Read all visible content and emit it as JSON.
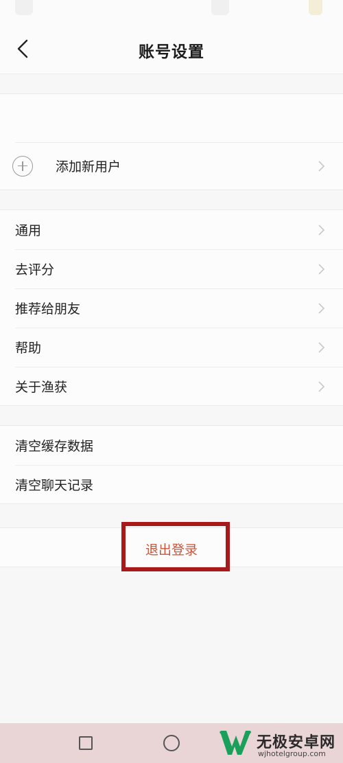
{
  "header": {
    "title": "账号设置"
  },
  "account_group": {
    "add_user_label": "添加新用户"
  },
  "general_group": {
    "items": [
      {
        "label": "通用"
      },
      {
        "label": "去评分"
      },
      {
        "label": "推荐给朋友"
      },
      {
        "label": "帮助"
      },
      {
        "label": "关于渔获"
      }
    ]
  },
  "data_group": {
    "items": [
      {
        "label": "清空缓存数据"
      },
      {
        "label": "清空聊天记录"
      }
    ]
  },
  "logout": {
    "label": "退出登录"
  },
  "watermark": {
    "name": "无极安卓网",
    "url": "wjhotelgroup.com"
  },
  "colors": {
    "logout_text": "#c9553a",
    "highlight_box": "#a8191c",
    "watermark_logo": "#1aa05a"
  }
}
